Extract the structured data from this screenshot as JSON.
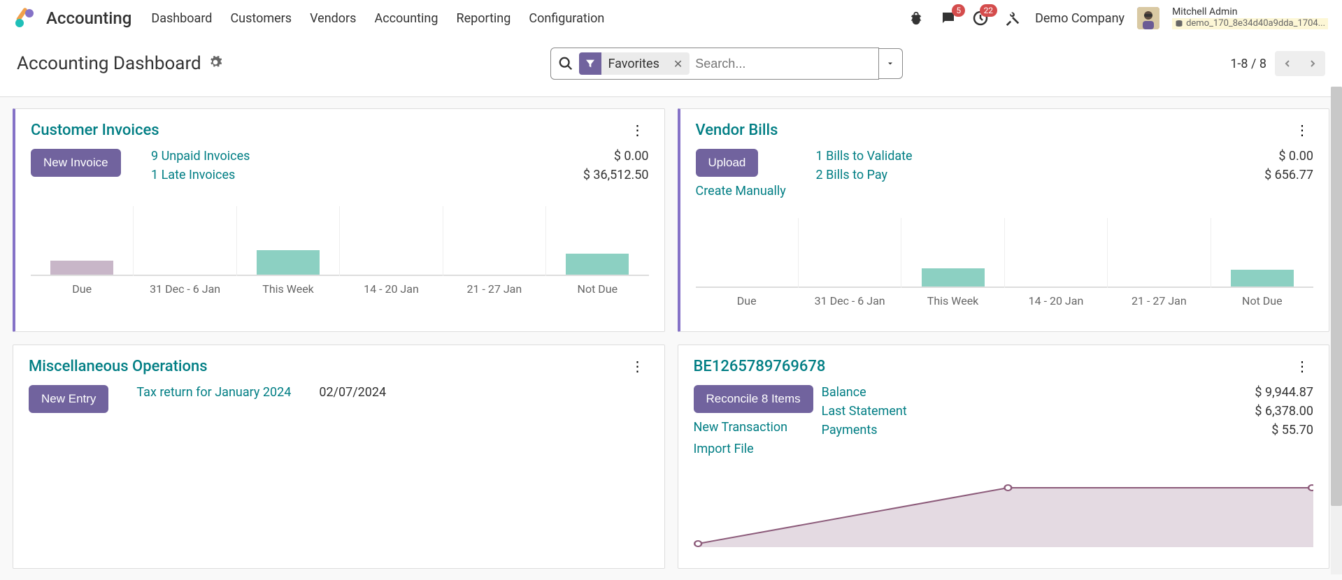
{
  "topnav": {
    "app_name": "Accounting",
    "menu": [
      "Dashboard",
      "Customers",
      "Vendors",
      "Accounting",
      "Reporting",
      "Configuration"
    ],
    "messages_badge": "5",
    "activities_badge": "22",
    "company": "Demo Company",
    "user_name": "Mitchell Admin",
    "db_name": "demo_170_8e34d40a9dda_1704..."
  },
  "control_panel": {
    "title": "Accounting Dashboard",
    "facet_label": "Favorites",
    "search_placeholder": "Search...",
    "pager": "1-8 / 8"
  },
  "cards": {
    "customer_invoices": {
      "title": "Customer Invoices",
      "button": "New Invoice",
      "links": [
        {
          "label": "9 Unpaid Invoices",
          "value": "$ 0.00"
        },
        {
          "label": "1 Late Invoices",
          "value": "$ 36,512.50"
        }
      ],
      "chart_data": {
        "type": "bar",
        "categories": [
          "Due",
          "31 Dec - 6 Jan",
          "This Week",
          "14 - 20 Jan",
          "21 - 27 Jan",
          "Not Due"
        ],
        "values": [
          20,
          0,
          35,
          0,
          0,
          30
        ],
        "colors": [
          "mauve",
          "",
          "teal",
          "",
          "",
          "teal"
        ]
      }
    },
    "vendor_bills": {
      "title": "Vendor Bills",
      "button": "Upload",
      "secondary_link": "Create Manually",
      "links": [
        {
          "label": "1 Bills to Validate",
          "value": "$ 0.00"
        },
        {
          "label": "2 Bills to Pay",
          "value": "$ 656.77"
        }
      ],
      "chart_data": {
        "type": "bar",
        "categories": [
          "Due",
          "31 Dec - 6 Jan",
          "This Week",
          "14 - 20 Jan",
          "21 - 27 Jan",
          "Not Due"
        ],
        "values": [
          0,
          0,
          26,
          0,
          0,
          24
        ],
        "colors": [
          "",
          "",
          "teal",
          "",
          "",
          "teal"
        ]
      }
    },
    "misc_ops": {
      "title": "Miscellaneous Operations",
      "button": "New Entry",
      "link": "Tax return for January 2024",
      "date": "02/07/2024"
    },
    "bank": {
      "title": "BE1265789769678",
      "button": "Reconcile 8 Items",
      "secondary_links": [
        "New Transaction",
        "Import File"
      ],
      "stats": [
        {
          "label": "Balance",
          "value": "$ 9,944.87"
        },
        {
          "label": "Last Statement",
          "value": "$ 6,378.00"
        },
        {
          "label": "Payments",
          "value": "$ 55.70"
        }
      ],
      "chart_data": {
        "type": "line",
        "points": [
          {
            "x": 0,
            "y": 0
          },
          {
            "x": 50,
            "y": 80
          },
          {
            "x": 100,
            "y": 80
          }
        ],
        "ylim": [
          0,
          100
        ]
      }
    }
  }
}
